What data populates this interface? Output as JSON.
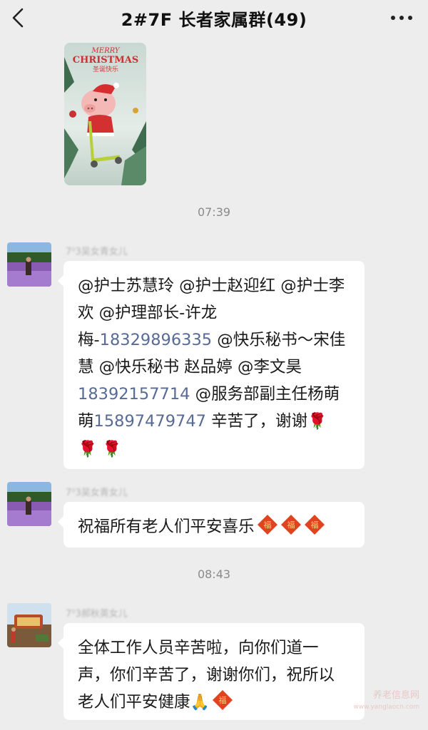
{
  "header": {
    "title": "2#7F  长者家属群(49)"
  },
  "sticker": {
    "line1": "MERRY",
    "line2": "CHRISTMAS",
    "line3": "圣诞快乐"
  },
  "timestamps": [
    "07:39",
    "08:43"
  ],
  "messages": [
    {
      "nickname": "7⁰3吴女青女儿",
      "parts": [
        {
          "t": "@护士苏慧玲 @护士赵迎红 @护士李欢 @护理部长-许龙梅-"
        },
        {
          "t": "18329896335",
          "phone": true
        },
        {
          "t": " @快乐秘书～宋佳慧 @快乐秘书 赵品婷 @李文昊 "
        },
        {
          "t": "18392157714",
          "phone": true
        },
        {
          "t": " @服务部副主任杨萌萌"
        },
        {
          "t": "15897479747",
          "phone": true
        },
        {
          "t": " 辛苦了，谢谢"
        }
      ],
      "emoji": "🌹 🌹 🌹"
    },
    {
      "nickname": "7⁰3吴女青女儿",
      "text": "祝福所有老人们平安喜乐",
      "fu_count": 3
    },
    {
      "nickname": "7⁰3郝秋英女儿",
      "text": "全体工作人员辛苦啦，向你们道一声，你们辛苦了，谢谢你们，祝所以老人们平安健康",
      "emoji": "🙏",
      "fu_count": 1
    }
  ],
  "watermark": {
    "line1": "养老信息网",
    "line2": "www.yanglaocn.com"
  },
  "colors": {
    "background": "#ededed",
    "bubble": "#ffffff",
    "phone_link": "#576b95",
    "timestamp": "#8a8a8a"
  },
  "icons": [
    "back-arrow-icon",
    "more-dots-icon",
    "rose-emoji-icon",
    "fu-diamond-icon",
    "pray-emoji-icon"
  ]
}
